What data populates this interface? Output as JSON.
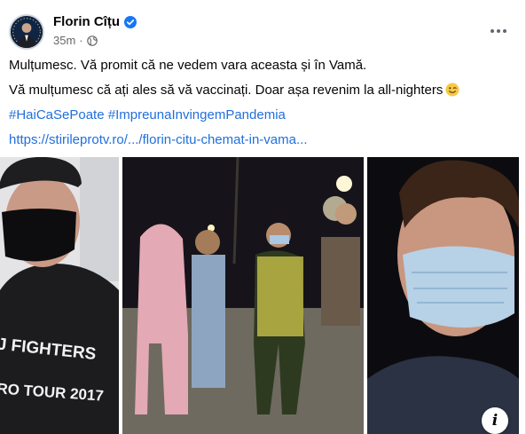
{
  "post": {
    "author": "Florin Cîțu",
    "time": "35m",
    "separator": "·",
    "lines": [
      "Mulțumesc. Vă promit că ne vedem vara aceasta și în Vamă.",
      "Vă mulțumesc că ați ales să vă vaccinați. Doar așa revenim la all-nighters"
    ],
    "hashtags": [
      "#HaiCaSePoate",
      "#ImpreunaInvingemPandemia"
    ],
    "link": "https://stirileprotv.ro/.../florin-citu-chemat-in-vama..."
  },
  "media": {
    "shirt_line1": "J FIGHTERS",
    "shirt_line2": "RO TOUR 2017",
    "info_label": "i"
  },
  "colors": {
    "link": "#216fdb",
    "verified": "#1877f2",
    "secondary_text": "#65676b"
  },
  "icons": [
    "verified-badge-icon",
    "globe-icon",
    "more-options-icon",
    "winking-face-icon",
    "info-icon"
  ]
}
